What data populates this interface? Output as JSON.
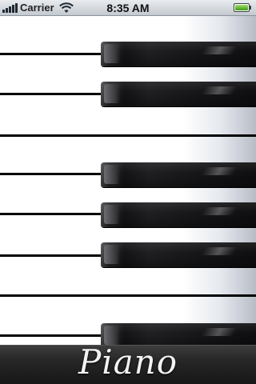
{
  "status_bar": {
    "carrier": "Carrier",
    "time": "8:35 AM",
    "battery_level": 1.0,
    "signal_bars": 5
  },
  "app": {
    "title": "Piano",
    "accent_colors": {
      "title_bar": "#262626",
      "title_text": "#f2f2f2",
      "black_key": "#141416"
    }
  },
  "keyboard": {
    "visible_keys": [
      {
        "kind": "white",
        "name": "white-key"
      },
      {
        "kind": "black",
        "name": "black-key"
      },
      {
        "kind": "white",
        "name": "white-key"
      },
      {
        "kind": "black",
        "name": "black-key"
      },
      {
        "kind": "white",
        "name": "white-key"
      },
      {
        "kind": "white",
        "name": "white-key"
      },
      {
        "kind": "black",
        "name": "black-key"
      },
      {
        "kind": "white",
        "name": "white-key"
      },
      {
        "kind": "black",
        "name": "black-key"
      },
      {
        "kind": "white",
        "name": "white-key"
      },
      {
        "kind": "black",
        "name": "black-key"
      },
      {
        "kind": "white",
        "name": "white-key"
      },
      {
        "kind": "white",
        "name": "white-key"
      },
      {
        "kind": "black",
        "name": "black-key"
      }
    ]
  }
}
